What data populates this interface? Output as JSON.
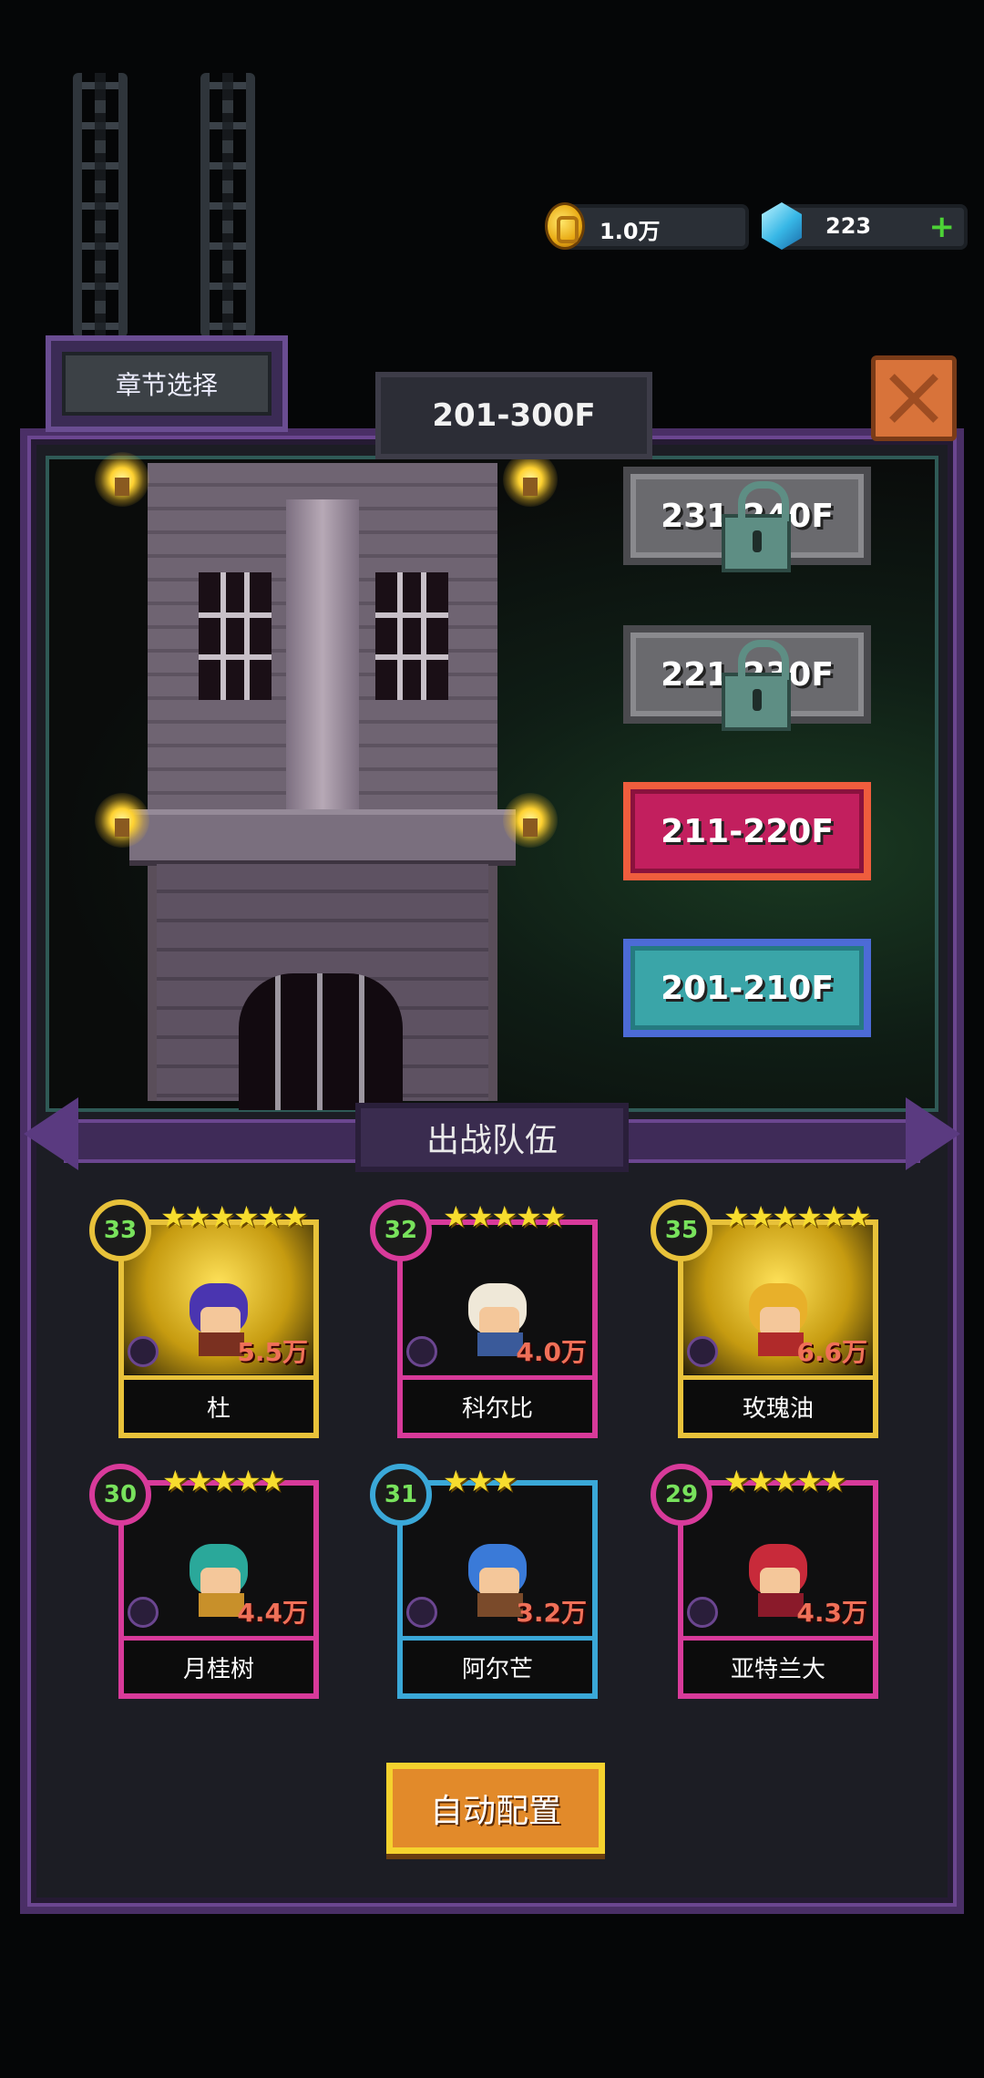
{
  "resources": {
    "gold": "1.0万",
    "gems": "223"
  },
  "header": {
    "chapter_select_label": "章节选择",
    "floor_range_title": "201-300F"
  },
  "floors": [
    {
      "label": "231-240F",
      "state": "locked"
    },
    {
      "label": "221-230F",
      "state": "locked"
    },
    {
      "label": "211-220F",
      "state": "current"
    },
    {
      "label": "201-210F",
      "state": "cleared"
    }
  ],
  "team": {
    "title": "出战队伍",
    "heroes": [
      {
        "name": "杜",
        "level": "33",
        "power": "5.5万",
        "stars": 6,
        "rarity": "gold"
      },
      {
        "name": "科尔比",
        "level": "32",
        "power": "4.0万",
        "stars": 5,
        "rarity": "pink"
      },
      {
        "name": "玫瑰油",
        "level": "35",
        "power": "6.6万",
        "stars": 6,
        "rarity": "gold"
      },
      {
        "name": "月桂树",
        "level": "30",
        "power": "4.4万",
        "stars": 5,
        "rarity": "pink"
      },
      {
        "name": "阿尔芒",
        "level": "31",
        "power": "3.2万",
        "stars": 3,
        "rarity": "blue"
      },
      {
        "name": "亚特兰大",
        "level": "29",
        "power": "4.3万",
        "stars": 5,
        "rarity": "pink"
      }
    ]
  },
  "auto_config_label": "自动配置",
  "colors": {
    "frame_purple": "#4a2f66",
    "current_floor": "#c21f5e",
    "cleared_floor": "#3aa5a8",
    "locked_floor": "#6a6a6e",
    "level_text": "#78e25c",
    "power_text": "#f07058"
  },
  "icons": [
    "coin-icon",
    "gem-icon",
    "plus-icon",
    "close-icon",
    "lock-icon",
    "star-icon",
    "class-icon"
  ]
}
